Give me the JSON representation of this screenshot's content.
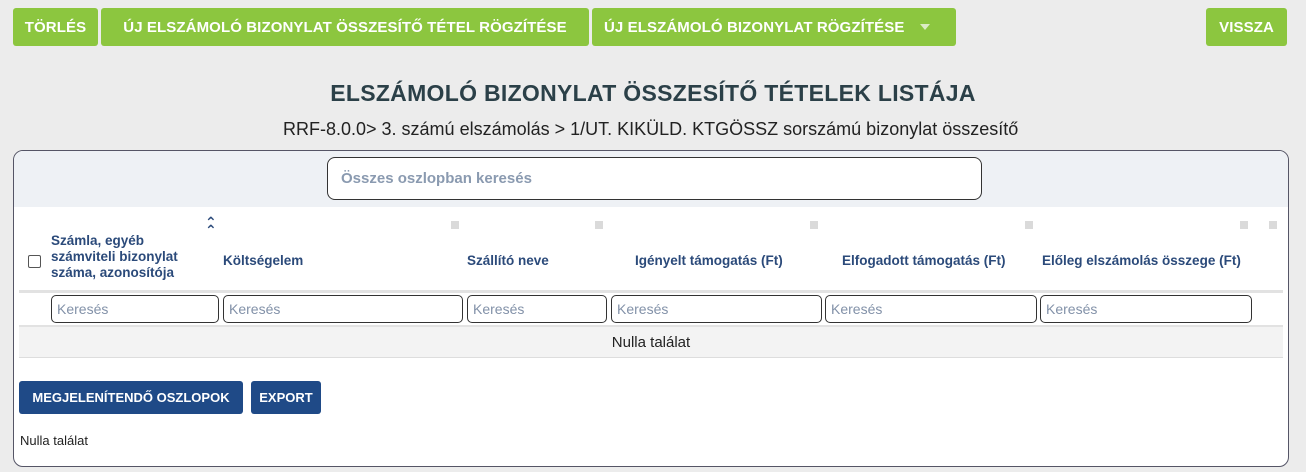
{
  "toolbar": {
    "delete_label": "TÖRLÉS",
    "new_summary_item_label": "ÚJ ELSZÁMOLÓ BIZONYLAT ÖSSZESÍTŐ TÉTEL RÖGZÍTÉSE",
    "new_voucher_label": "ÚJ ELSZÁMOLÓ BIZONYLAT RÖGZÍTÉSE",
    "back_label": "VISSZA"
  },
  "page": {
    "title": "ELSZÁMOLÓ BIZONYLAT ÖSSZESÍTŐ TÉTELEK LISTÁJA",
    "breadcrumb": "RRF-8.0.0> 3. számú elszámolás > 1/UT. KIKÜLD. KTGÖSSZ sorszámú bizonylat összesítő"
  },
  "table": {
    "global_search_placeholder": "Összes oszlopban keresés",
    "columns": [
      {
        "label": "Számla, egyéb számviteli bizonylat száma, azonosítója",
        "filter_placeholder": "Keresés"
      },
      {
        "label": "Költségelem",
        "filter_placeholder": "Keresés"
      },
      {
        "label": "Szállító neve",
        "filter_placeholder": "Keresés"
      },
      {
        "label": "Igényelt támogatás (Ft)",
        "filter_placeholder": "Keresés"
      },
      {
        "label": "Elfogadott támogatás (Ft)",
        "filter_placeholder": "Keresés"
      },
      {
        "label": "Előleg elszámolás összege (Ft)",
        "filter_placeholder": "Keresés"
      }
    ],
    "empty_message": "Nulla találat",
    "sort_icon": "double-chevron-up-icon"
  },
  "footer": {
    "columns_button_label": "MEGJELENÍTENDŐ OSZLOPOK",
    "export_button_label": "EXPORT",
    "result_count": "Nulla találat"
  },
  "colors": {
    "primary_green": "#8cc63f",
    "primary_blue": "#1f4a87",
    "heading": "#2b4048",
    "column_header": "#2b4a7a"
  }
}
